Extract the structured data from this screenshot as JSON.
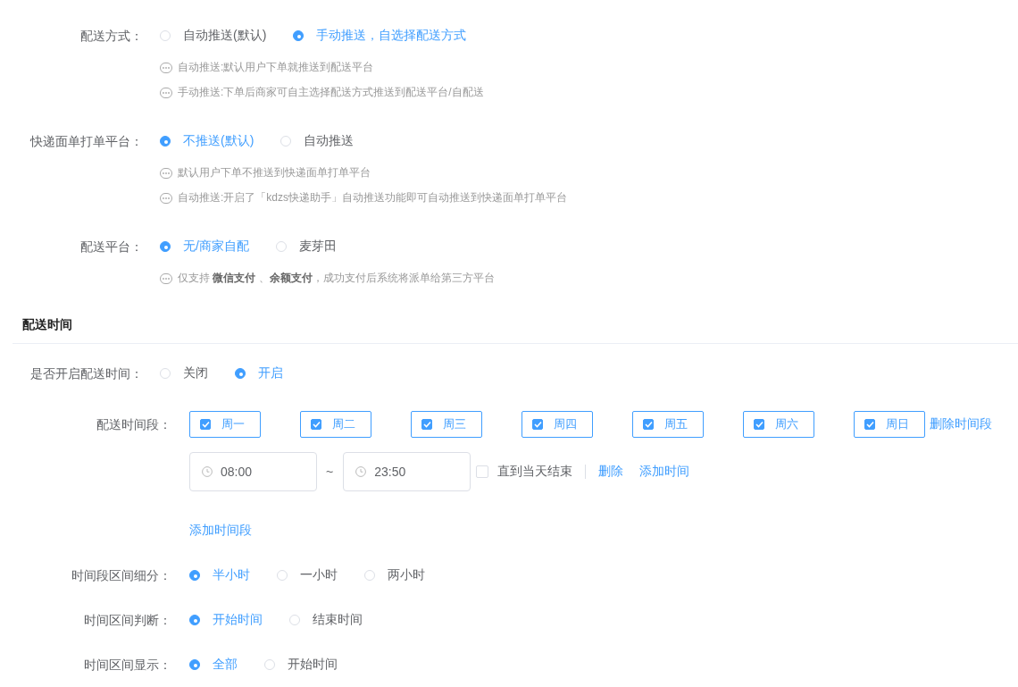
{
  "settings": [
    {
      "label": "配送方式：",
      "options": [
        {
          "label": "自动推送(默认)",
          "selected": false
        },
        {
          "label": "手动推送，自选择配送方式",
          "selected": true
        }
      ],
      "hints": [
        "自动推送:默认用户下单就推送到配送平台",
        "手动推送:下单后商家可自主选择配送方式推送到配送平台/自配送"
      ]
    },
    {
      "label": "快递面单打单平台：",
      "options": [
        {
          "label": "不推送(默认)",
          "selected": true
        },
        {
          "label": "自动推送",
          "selected": false
        }
      ],
      "hints": [
        "默认用户下单不推送到快递面单打单平台",
        "自动推送:开启了「kdzs快递助手」自动推送功能即可自动推送到快递面单打单平台"
      ]
    },
    {
      "label": "配送平台：",
      "options": [
        {
          "label": "无/商家自配",
          "selected": true
        },
        {
          "label": "麦芽田",
          "selected": false
        }
      ],
      "hints": [
        "仅支持 **微信支付** 、**余额支付**，成功支付后系统将派单给第三方平台"
      ]
    }
  ],
  "delivery_time": {
    "title": "配送时间",
    "enable": {
      "label": "是否开启配送时间：",
      "options": [
        {
          "label": "关闭",
          "selected": false
        },
        {
          "label": "开启",
          "selected": true
        }
      ]
    },
    "periods": {
      "label": "配送时间段：",
      "days": [
        {
          "label": "周一",
          "checked": true
        },
        {
          "label": "周二",
          "checked": true
        },
        {
          "label": "周三",
          "checked": true
        },
        {
          "label": "周四",
          "checked": true
        },
        {
          "label": "周五",
          "checked": true
        },
        {
          "label": "周六",
          "checked": true
        },
        {
          "label": "周日",
          "checked": true
        }
      ],
      "delete_period": "删除时间段",
      "ranges": [
        {
          "start": "08:00",
          "separator": "~",
          "end": "23:50",
          "until_end": {
            "label": "直到当天结束",
            "checked": false
          },
          "delete": "删除",
          "add": "添加时间"
        }
      ],
      "add_period": "添加时间段"
    },
    "more": [
      {
        "label": "时间段区间细分：",
        "options": [
          {
            "label": "半小时",
            "selected": true
          },
          {
            "label": "一小时",
            "selected": false
          },
          {
            "label": "两小时",
            "selected": false
          }
        ]
      },
      {
        "label": "时间区间判断：",
        "options": [
          {
            "label": "开始时间",
            "selected": true
          },
          {
            "label": "结束时间",
            "selected": false
          }
        ]
      },
      {
        "label": "时间区间显示：",
        "options": [
          {
            "label": "全部",
            "selected": true
          },
          {
            "label": "开始时间",
            "selected": false
          }
        ]
      }
    ]
  }
}
